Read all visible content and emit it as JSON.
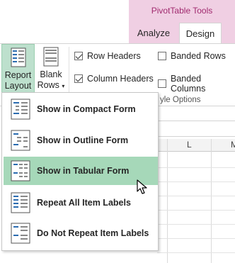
{
  "ribbon": {
    "tool_tab_title": "PivotTable Tools",
    "tabs": [
      {
        "label": "Analyze",
        "active": false
      },
      {
        "label": "Design",
        "active": true
      }
    ],
    "report_layout_button": {
      "line1": "Report",
      "line2": "Layout",
      "caret": "▾"
    },
    "blank_rows_button": {
      "line1": "Blank",
      "line2": "Rows",
      "caret": "▾"
    },
    "options": {
      "row_headers": {
        "label": "Row Headers",
        "checked": true
      },
      "column_headers": {
        "label": "Column Headers",
        "checked": true
      },
      "banded_rows": {
        "label": "Banded Rows",
        "checked": false
      },
      "banded_columns": {
        "label": "Banded Columns",
        "checked": false
      }
    },
    "group_label": "yle Options"
  },
  "sheet": {
    "column_letters": [
      "L",
      "M"
    ]
  },
  "menu": {
    "items": [
      {
        "label": "Show in Compact Form",
        "icon": "compact-form-icon",
        "hover": false
      },
      {
        "label": "Show in Outline Form",
        "icon": "outline-form-icon",
        "hover": false
      },
      {
        "label": "Show in Tabular Form",
        "icon": "tabular-form-icon",
        "hover": true
      },
      {
        "label": "Repeat All Item Labels",
        "icon": "repeat-labels-icon",
        "hover": false
      },
      {
        "label": "Do Not Repeat Item Labels",
        "icon": "no-repeat-labels-icon",
        "hover": false
      }
    ]
  },
  "colors": {
    "tool_tab_band": "#f0cfe3",
    "tool_tab_text": "#a0296e",
    "selected_button": "#bde0cd",
    "menu_hover": "#a6d8b9"
  }
}
